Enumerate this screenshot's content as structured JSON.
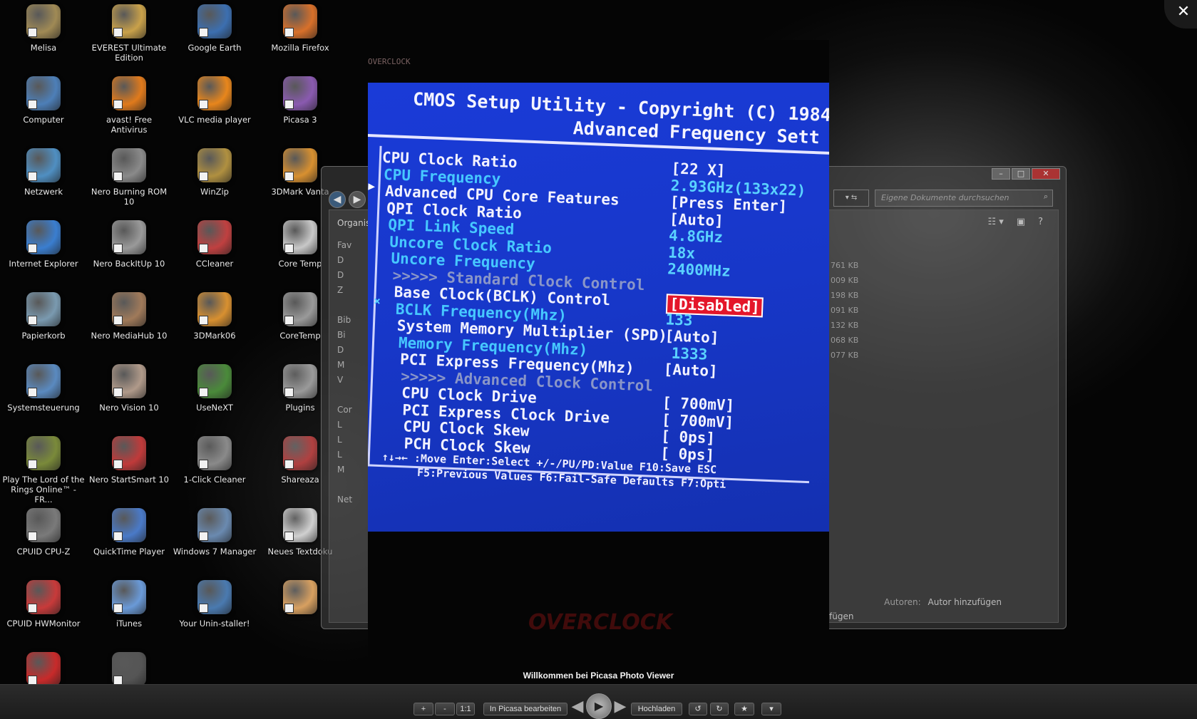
{
  "desktop": {
    "icons": [
      {
        "label": "Melisa",
        "color": "#a08a55"
      },
      {
        "label": "EVEREST Ultimate Edition",
        "color": "#c9a14a"
      },
      {
        "label": "Google Earth",
        "color": "#3c6fb0"
      },
      {
        "label": "Mozilla Firefox",
        "color": "#d8702a"
      },
      {
        "label": "Computer",
        "color": "#4d7fb8"
      },
      {
        "label": "avast! Free Antivirus",
        "color": "#e07a1c"
      },
      {
        "label": "VLC media player",
        "color": "#e8861c"
      },
      {
        "label": "Picasa 3",
        "color": "#8a5ab0"
      },
      {
        "label": "Netzwerk",
        "color": "#4f8fc2"
      },
      {
        "label": "Nero Burning ROM 10",
        "color": "#8a8a8a"
      },
      {
        "label": "WinZip",
        "color": "#b09040"
      },
      {
        "label": "3DMark Vanta",
        "color": "#d89030"
      },
      {
        "label": "Internet Explorer",
        "color": "#3a7ed0"
      },
      {
        "label": "Nero BackItUp 10",
        "color": "#9a9a9a"
      },
      {
        "label": "CCleaner",
        "color": "#c04040"
      },
      {
        "label": "Core Temp",
        "color": "#c8c8c8"
      },
      {
        "label": "Papierkorb",
        "color": "#7a9ab0"
      },
      {
        "label": "Nero MediaHub 10",
        "color": "#a07a5a"
      },
      {
        "label": "3DMark06",
        "color": "#d89030"
      },
      {
        "label": "CoreTemp",
        "color": "#9a9a9a"
      },
      {
        "label": "Systemsteuerung",
        "color": "#5a8ac0"
      },
      {
        "label": "Nero Vision 10",
        "color": "#b09a8a"
      },
      {
        "label": "UseNeXT",
        "color": "#4a8a3a"
      },
      {
        "label": "Plugins",
        "color": "#9a9a9a"
      },
      {
        "label": "Play The Lord of the Rings Online™ - FR...",
        "color": "#7a8a3a"
      },
      {
        "label": "Nero StartSmart 10",
        "color": "#c03a3a"
      },
      {
        "label": "1-Click Cleaner",
        "color": "#8a8a8a"
      },
      {
        "label": "Shareaza",
        "color": "#b04040"
      },
      {
        "label": "CPUID CPU-Z",
        "color": "#7a7a7a"
      },
      {
        "label": "QuickTime Player",
        "color": "#4a7ac8"
      },
      {
        "label": "Windows 7 Manager",
        "color": "#6a8ab0"
      },
      {
        "label": "Neues Textdoku",
        "color": "#d0d0d0"
      },
      {
        "label": "CPUID HWMonitor",
        "color": "#c83a3a"
      },
      {
        "label": "iTunes",
        "color": "#6a9ad8"
      },
      {
        "label": "Your Unin-staller!",
        "color": "#4a7ab0"
      },
      {
        "label": "",
        "color": "#d8a060"
      },
      {
        "label": "",
        "color": "#c82a2a"
      },
      {
        "label": "",
        "color": "#555555"
      }
    ]
  },
  "explorer": {
    "organize": "Organis",
    "tree": [
      "Fav",
      "D",
      "D",
      "Z",
      "",
      "Bib",
      "Bi",
      "D",
      "M",
      "V",
      "",
      "Cor",
      "L",
      "L",
      "L",
      "M",
      "",
      "Net"
    ],
    "search_placeholder": "Eigene Dokumente durchsuchen",
    "sizes": [
      "761 KB",
      "009 KB",
      "198 KB",
      "091 KB",
      "132 KB",
      "068 KB",
      "077 KB"
    ],
    "authors_label": "Autoren:",
    "authors_value": "Autor hinzufügen",
    "add_text": "fügen"
  },
  "photo": {
    "brand": "OVERCLOCK",
    "header_line1": "CMOS Setup Utility - Copyright (C) 1984-",
    "header_line2": "Advanced Frequency Sett",
    "rows": [
      {
        "label": "CPU Clock Ratio",
        "value": "[22 X]",
        "style": "white"
      },
      {
        "label": "CPU Frequency",
        "value": "2.93GHz(133x22)",
        "style": "cyan"
      },
      {
        "label": "Advanced CPU Core Features",
        "value": "[Press Enter]",
        "style": "white"
      },
      {
        "label": "QPI Clock Ratio",
        "value": "[Auto]",
        "style": "white"
      },
      {
        "label": "QPI Link Speed",
        "value": "4.8GHz",
        "style": "cyan"
      },
      {
        "label": "Uncore Clock Ratio",
        "value": "18x",
        "style": "cyan"
      },
      {
        "label": "Uncore Frequency",
        "value": "2400MHz",
        "style": "cyan"
      },
      {
        "label": ">>>>>  Standard Clock Control",
        "value": "",
        "style": "dim"
      },
      {
        "label": "Base Clock(BCLK) Control",
        "value": "[Disabled]",
        "style": "white",
        "selected": true
      },
      {
        "label": "BCLK Frequency(Mhz)",
        "value": "133",
        "style": "cyan"
      },
      {
        "label": "System Memory Multiplier (SPD)",
        "value": "[Auto]",
        "style": "white"
      },
      {
        "label": "Memory Frequency(Mhz)      1333",
        "value": "1333",
        "style": "cyan"
      },
      {
        "label": "PCI Express Frequency(Mhz)",
        "value": "[Auto]",
        "style": "white"
      },
      {
        "label": ">>>>>  Advanced Clock Control",
        "value": "",
        "style": "dim"
      },
      {
        "label": "CPU Clock Drive",
        "value": "[ 700mV]",
        "style": "white"
      },
      {
        "label": "PCI Express Clock Drive",
        "value": "[ 700mV]",
        "style": "white"
      },
      {
        "label": "CPU Clock Skew",
        "value": "[   0ps]",
        "style": "white"
      },
      {
        "label": "PCH Clock Skew",
        "value": "[   0ps]",
        "style": "white"
      }
    ],
    "footer_line1": "↑↓→← :Move   Enter:Select   +/-/PU/PD:Value   F10:Save   ESC",
    "footer_line2": "F5:Previous Values    F6:Fail-Safe Defaults   F7:Opti",
    "watermark": "OVERCLOCK"
  },
  "viewer": {
    "caption": "Willkommen bei Picasa Photo Viewer",
    "zoom_in": "+",
    "zoom_out": "-",
    "actual_size": "1:1",
    "edit_label": "In Picasa bearbeiten",
    "upload_label": "Hochladen"
  }
}
